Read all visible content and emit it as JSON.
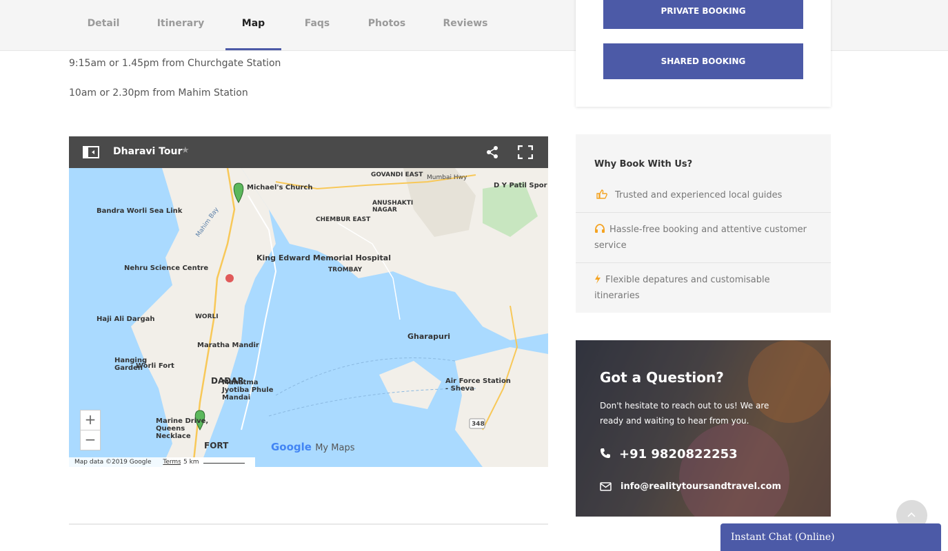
{
  "tabs": [
    {
      "label": "Detail",
      "active": false
    },
    {
      "label": "Itinerary",
      "active": false
    },
    {
      "label": "Map",
      "active": true
    },
    {
      "label": "Faqs",
      "active": false
    },
    {
      "label": "Photos",
      "active": false
    },
    {
      "label": "Reviews",
      "active": false
    }
  ],
  "schedule": [
    "9:15am or 1.45pm from Churchgate Station",
    "10am or 2.30pm from Mahim Station"
  ],
  "map": {
    "title": "Dharavi Tour",
    "star": "★",
    "zoom_in": "+",
    "zoom_out": "−",
    "copyright": "Map data ©2019 Google",
    "terms": "Terms",
    "scale": "5 km",
    "logo": "Google",
    "logo_suffix": "My Maps",
    "water_color": "#aadaff",
    "land_color": "#f2efe9",
    "labels": {
      "sea_link": "Bandra Worli Sea Link",
      "church": "Michael's Church",
      "govandi": "GOVANDI EAST",
      "mumbai_hwy": "Mumbai Hwy",
      "dy_patil": "D Y Patil Spor",
      "anushakti": "ANUSHAKTI NAGAR",
      "mahim_bay": "Mahim Bay",
      "chembur": "CHEMBUR EAST",
      "worli_fort": "Worli Fort",
      "dadar": "DADAR",
      "nehru": "Nehru Science Centre",
      "kem": "King Edward Memorial Hospital",
      "trombay": "TROMBAY",
      "worli": "WORLI",
      "haji_ali": "Haji Ali Dargah",
      "maratha": "Maratha Mandir",
      "hanging": "Hanging Garden",
      "gharapuri": "Gharapuri",
      "airforce": "Air Force Station - Sheva",
      "phule": "Mahatma Jyotiba Phule Mandai",
      "marine": "Marine Drive, Queens Necklace",
      "fort": "FORT",
      "road_348": "348"
    }
  },
  "booking": {
    "private": "PRIVATE BOOKING",
    "shared": "SHARED BOOKING"
  },
  "why": {
    "title": "Why Book With Us?",
    "items": [
      {
        "icon": "thumbs-up-icon",
        "text": "Trusted and experienced local guides"
      },
      {
        "icon": "headphones-icon",
        "text": "Hassle-free booking and attentive customer service"
      },
      {
        "icon": "bolt-icon",
        "text": "Flexible depatures and customisable itineraries"
      }
    ],
    "icon_color": "#f4a322"
  },
  "question": {
    "title": "Got a Question?",
    "text": "Don't hesitate to reach out to us! We are ready and waiting to hear from you.",
    "phone": "+91 9820822253",
    "email": "info@realitytoursandtravel.com"
  },
  "chat": {
    "label": "Instant Chat (Online)"
  },
  "colors": {
    "accent": "#4c5aa7"
  }
}
